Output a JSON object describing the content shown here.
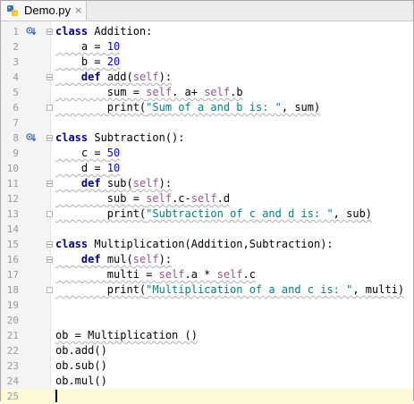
{
  "tab": {
    "label": "Demo.py",
    "close": "×",
    "icon": "python-file-icon"
  },
  "lines": [
    {
      "n": "1",
      "tokens": [
        [
          "kw",
          "class"
        ],
        [
          "",
          " Addition:"
        ]
      ]
    },
    {
      "n": "2",
      "tokens": [
        [
          "",
          "    a = "
        ],
        [
          "num",
          "10"
        ]
      ]
    },
    {
      "n": "3",
      "tokens": [
        [
          "",
          "    b = "
        ],
        [
          "num",
          "20"
        ]
      ]
    },
    {
      "n": "4",
      "tokens": [
        [
          "",
          "    "
        ],
        [
          "kw",
          "def"
        ],
        [
          "",
          " add("
        ],
        [
          "selfk",
          "self"
        ],
        [
          "",
          "):"
        ]
      ]
    },
    {
      "n": "5",
      "tokens": [
        [
          "",
          "        sum = "
        ],
        [
          "selfk",
          "self"
        ],
        [
          "",
          ". a+ "
        ],
        [
          "selfk",
          "self"
        ],
        [
          "",
          ".b"
        ]
      ]
    },
    {
      "n": "6",
      "tokens": [
        [
          "",
          "        print("
        ],
        [
          "str",
          "\"Sum of a and b is: \""
        ],
        [
          "",
          ", sum)"
        ]
      ]
    },
    {
      "n": "7",
      "tokens": []
    },
    {
      "n": "8",
      "tokens": [
        [
          "kw",
          "class"
        ],
        [
          "",
          " Subtraction():"
        ]
      ]
    },
    {
      "n": "9",
      "tokens": [
        [
          "",
          "    c = "
        ],
        [
          "num",
          "50"
        ]
      ]
    },
    {
      "n": "10",
      "tokens": [
        [
          "",
          "    d = "
        ],
        [
          "num",
          "10"
        ]
      ]
    },
    {
      "n": "11",
      "tokens": [
        [
          "",
          "    "
        ],
        [
          "kw",
          "def"
        ],
        [
          "",
          " sub("
        ],
        [
          "selfk",
          "self"
        ],
        [
          "",
          "):"
        ]
      ]
    },
    {
      "n": "12",
      "tokens": [
        [
          "",
          "        sub = "
        ],
        [
          "selfk",
          "self"
        ],
        [
          "",
          ".c-"
        ],
        [
          "selfk",
          "self"
        ],
        [
          "",
          ".d"
        ]
      ]
    },
    {
      "n": "13",
      "tokens": [
        [
          "",
          "        print("
        ],
        [
          "str",
          "\"Subtraction of c and d is: \""
        ],
        [
          "",
          ", sub)"
        ]
      ]
    },
    {
      "n": "14",
      "tokens": []
    },
    {
      "n": "15",
      "tokens": [
        [
          "kw",
          "class"
        ],
        [
          "",
          " Multiplication(Addition,Subtraction):"
        ]
      ]
    },
    {
      "n": "16",
      "tokens": [
        [
          "",
          "    "
        ],
        [
          "kw",
          "def"
        ],
        [
          "",
          " mul("
        ],
        [
          "selfk",
          "self"
        ],
        [
          "",
          "):"
        ]
      ]
    },
    {
      "n": "17",
      "tokens": [
        [
          "",
          "        multi = "
        ],
        [
          "selfk",
          "self"
        ],
        [
          "",
          ".a * "
        ],
        [
          "selfk",
          "self"
        ],
        [
          "",
          ".c"
        ]
      ]
    },
    {
      "n": "18",
      "tokens": [
        [
          "",
          "        print("
        ],
        [
          "str",
          "\"Multiplication of a and c is: \""
        ],
        [
          "",
          ", multi)"
        ]
      ]
    },
    {
      "n": "19",
      "tokens": []
    },
    {
      "n": "20",
      "tokens": []
    },
    {
      "n": "21",
      "tokens": [
        [
          "",
          "ob = Multiplication ()"
        ]
      ]
    },
    {
      "n": "22",
      "tokens": [
        [
          "",
          "ob.add()"
        ]
      ]
    },
    {
      "n": "23",
      "tokens": [
        [
          "",
          "ob.sub()"
        ]
      ]
    },
    {
      "n": "24",
      "tokens": [
        [
          "",
          "ob.mul()"
        ]
      ]
    },
    {
      "n": "25",
      "tokens": []
    }
  ],
  "gutter_icons": [
    {
      "line": "1",
      "icon": "overridden-method-icon"
    },
    {
      "line": "8",
      "icon": "overridden-method-icon"
    }
  ],
  "colors": {
    "keyword": "#000080",
    "number": "#0000ff",
    "self": "#94558d",
    "string": "#008080",
    "current_line": "#fcfad9",
    "gutter": "#f4f4f4"
  }
}
